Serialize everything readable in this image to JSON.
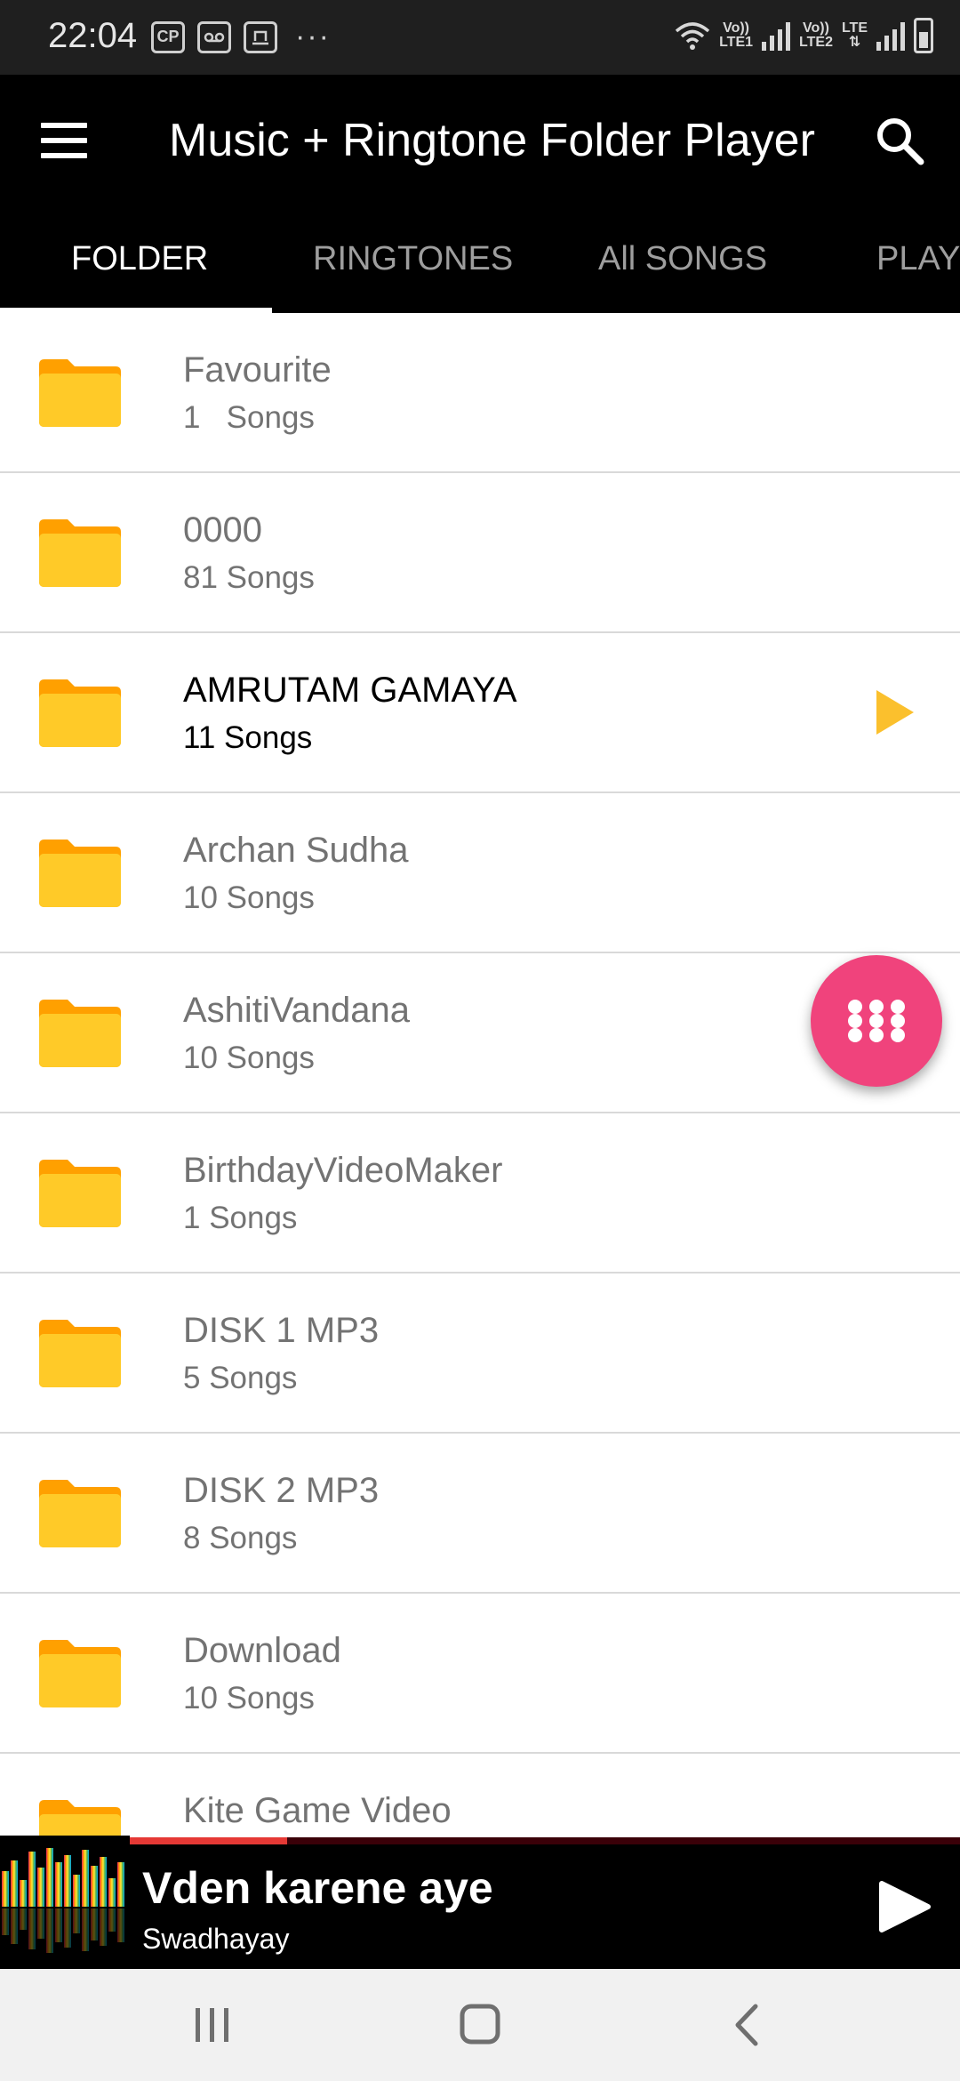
{
  "status_bar": {
    "time": "22:04",
    "notification_icons": [
      "cp-icon",
      "voicemail-icon",
      "cloud-upload-icon"
    ],
    "more": "···",
    "sim1_top": "Vo))",
    "sim1_bottom": "LTE1",
    "sim2_top": "Vo))",
    "sim2_bottom": "LTE2",
    "lte_label": "LTE"
  },
  "app_bar": {
    "title": "Music + Ringtone Folder Player",
    "menu_icon": "hamburger-menu-icon",
    "search_icon": "search-icon"
  },
  "tabs": [
    {
      "label": "FOLDER",
      "active": true
    },
    {
      "label": "RINGTONES",
      "active": false
    },
    {
      "label": "All SONGS",
      "active": false
    },
    {
      "label": "PLAY",
      "active": false
    }
  ],
  "folders": [
    {
      "name": "Favourite",
      "count": "1   Songs"
    },
    {
      "name": "0000",
      "count": "81 Songs"
    },
    {
      "name": "AMRUTAM GAMAYA",
      "count": "11 Songs",
      "playing": true
    },
    {
      "name": "Archan Sudha",
      "count": "10 Songs"
    },
    {
      "name": "AshitiVandana",
      "count": "10 Songs"
    },
    {
      "name": "BirthdayVideoMaker",
      "count": "1 Songs"
    },
    {
      "name": "DISK 1 MP3",
      "count": "5 Songs"
    },
    {
      "name": "DISK 2 MP3",
      "count": "8 Songs"
    },
    {
      "name": "Download",
      "count": "10 Songs"
    },
    {
      "name": "Kite Game Video",
      "count": ""
    }
  ],
  "fab": {
    "icon": "grid-dots-icon"
  },
  "now_playing": {
    "title": "Vden karene aye",
    "artist": "Swadhayay",
    "progress_fraction": 0.19,
    "play_icon": "play-icon"
  },
  "colors": {
    "accent_folder": "#FFCA28",
    "play_triangle": "#FBC02D",
    "fab": "#F0437C",
    "progress": "#E53935"
  },
  "nav_bar": [
    "recents-icon",
    "home-icon",
    "back-icon"
  ]
}
